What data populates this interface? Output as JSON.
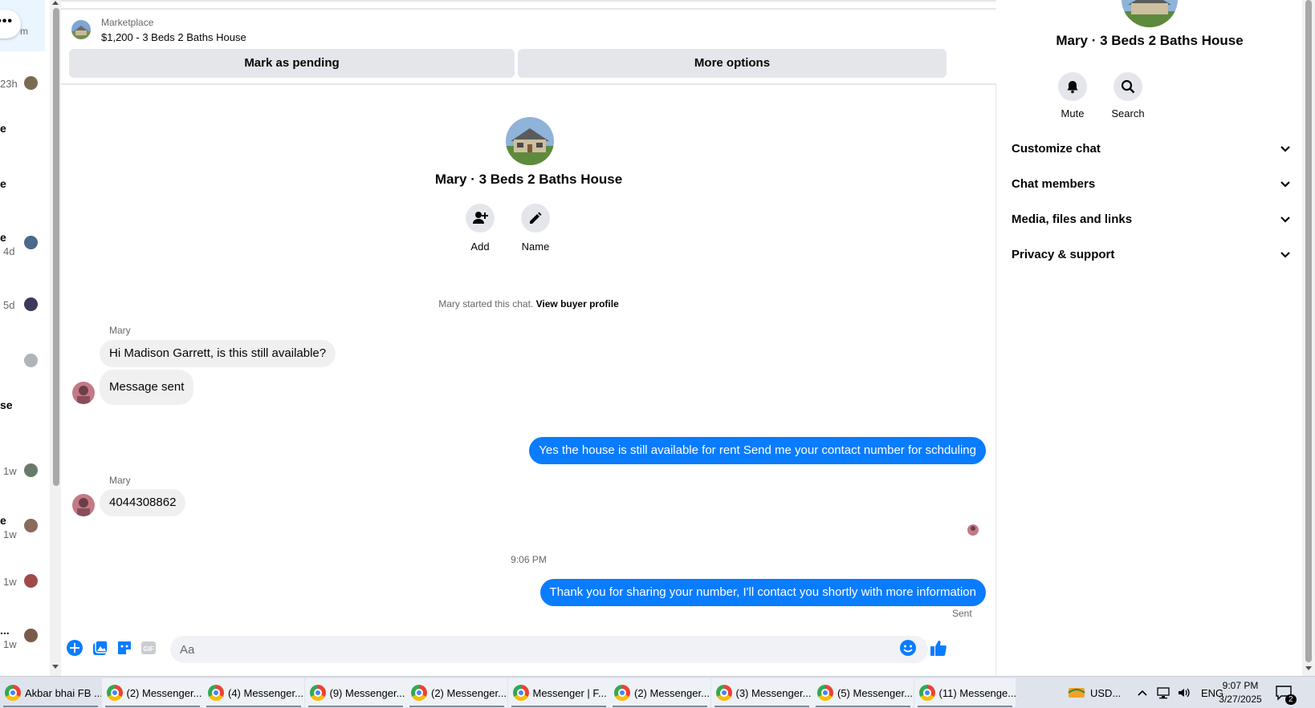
{
  "left_list": {
    "partial_label": "m",
    "rows": [
      {
        "time": "23h",
        "letter": "",
        "avatar_color": "#7a6a52"
      },
      {
        "time": "",
        "letter": "e",
        "avatar_color": ""
      },
      {
        "time": "",
        "letter": "e",
        "avatar_color": ""
      },
      {
        "time": "4d",
        "letter": "e",
        "avatar_color": "#4a6a8a"
      },
      {
        "time": "5d",
        "letter": "",
        "avatar_color": "#3a3a5a"
      },
      {
        "time": "",
        "letter": "",
        "avatar_color": "#b0b3b8"
      },
      {
        "time": "",
        "letter": "se",
        "avatar_color": ""
      },
      {
        "time": "1w",
        "letter": "",
        "avatar_color": "#6a7a6a"
      },
      {
        "time": "1w",
        "letter": "e",
        "avatar_color": "#8a6a5a"
      },
      {
        "time": "1w",
        "letter": "",
        "avatar_color": "#a04a4a"
      },
      {
        "time": "1w",
        "letter": "...",
        "avatar_color": "#7a5a4a"
      }
    ]
  },
  "marketplace": {
    "label": "Marketplace",
    "listing": "$1,200 - 3 Beds 2 Baths House",
    "pending_button": "Mark as pending",
    "more_button": "More options"
  },
  "conversation": {
    "title": "Mary · 3 Beds 2 Baths House",
    "add_label": "Add",
    "name_label": "Name",
    "started_text": "Mary started this chat.",
    "buyer_profile_link": "View buyer profile"
  },
  "messages": [
    {
      "sender": "Mary",
      "direction": "in",
      "text": "Hi Madison Garrett, is this still available?"
    },
    {
      "sender": "",
      "direction": "in",
      "text": "Message sent"
    },
    {
      "sender": "",
      "direction": "out",
      "text": "Yes the house is still available for rent Send me your contact number for schduling"
    },
    {
      "sender": "Mary",
      "direction": "in",
      "text": "4044308862"
    },
    {
      "sender": "",
      "direction": "out",
      "text": "Thank you for sharing your number, I'll contact you shortly with more information"
    }
  ],
  "timestamp": "9:06 PM",
  "sent_status": "Sent",
  "composer": {
    "placeholder": "Aa",
    "icons": [
      "plus-circle-icon",
      "photo-icon",
      "sticker-icon",
      "gif-icon",
      "emoji-icon",
      "thumbs-up-icon"
    ]
  },
  "right_panel": {
    "title": "Mary · 3 Beds 2 Baths House",
    "mute_label": "Mute",
    "search_label": "Search",
    "sections": [
      "Customize chat",
      "Chat members",
      "Media, files and links",
      "Privacy & support"
    ]
  },
  "taskbar": {
    "items": [
      "Akbar bhai FB ...",
      "(2) Messenger...",
      "(4) Messenger...",
      "(9) Messenger...",
      "(2) Messenger...",
      "Messenger | F...",
      "(2) Messenger...",
      "(3) Messenger...",
      "(5) Messenger...",
      "(11) Messenge..."
    ],
    "currency": "USD...",
    "language": "ENG",
    "time": "9:07 PM",
    "date": "3/27/2025",
    "notification_count": "2"
  },
  "colors": {
    "accent_blue": "#0a7cff",
    "incoming_bubble": "#f0f0f0",
    "button_gray": "#e4e6eb"
  }
}
